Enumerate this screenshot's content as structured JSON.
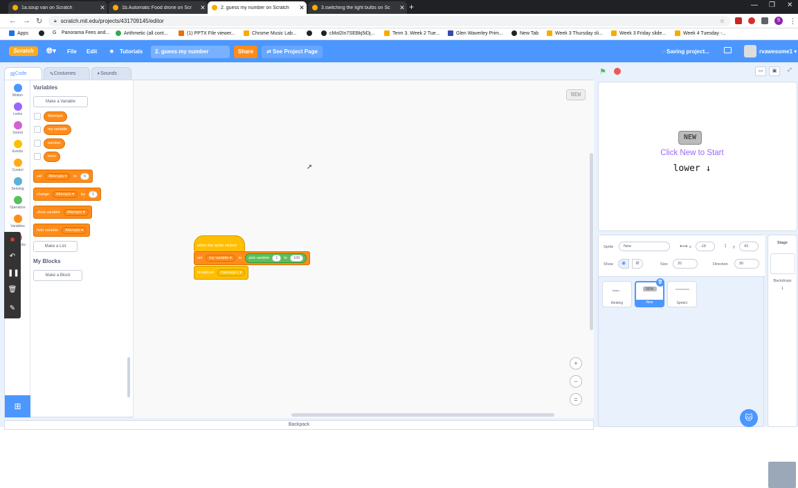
{
  "browser": {
    "tabs": [
      {
        "label": "1a.soup van on Scratch",
        "active": false
      },
      {
        "label": "1b.Automatic Food drone on Scr",
        "active": false
      },
      {
        "label": "2. guess my number on Scratch",
        "active": true
      },
      {
        "label": "3.switching the light bulbs on Sc",
        "active": false
      }
    ],
    "new_tab": "+",
    "url": "scratch.mit.edu/projects/431709145/editor",
    "profile_initial": "S",
    "bookmarks": [
      "Apps",
      "G",
      "Panorama Fees and...",
      "Arithmetic (all cont...",
      "(1) PPTX File viewer...",
      "Chrome Music Lab...",
      "cMol2In7SEBkj5iDj...",
      "Term 3. Week 2 Tue...",
      "Glen Waverley Prim...",
      "New Tab",
      "Week 3 Thursday sli...",
      "Week 3 Friday slide...",
      "Week 4 Tuesday -..."
    ]
  },
  "menubar": {
    "logo": "Scratch",
    "file": "File",
    "edit": "Edit",
    "tutorials": "Tutorials",
    "project_title": "2. guess my number",
    "share": "Share",
    "see_project_page": "See Project Page",
    "saving": "Saving project...",
    "username": "rvawesome1",
    "color": "#4c97ff"
  },
  "editor_tabs": {
    "code": "Code",
    "costumes": "Costumes",
    "sounds": "Sounds"
  },
  "categories": [
    {
      "label": "Motion",
      "color": "#4c97ff"
    },
    {
      "label": "Looks",
      "color": "#9966ff"
    },
    {
      "label": "Sound",
      "color": "#cf63cf"
    },
    {
      "label": "Events",
      "color": "#ffbf00"
    },
    {
      "label": "Control",
      "color": "#ffab19"
    },
    {
      "label": "Sensing",
      "color": "#5cb1d6"
    },
    {
      "label": "Operators",
      "color": "#59c059"
    },
    {
      "label": "Variables",
      "color": "#ff8c1a"
    },
    {
      "label": "My Blocks",
      "color": "#ff6680"
    }
  ],
  "palette": {
    "variables_title": "Variables",
    "make_variable": "Make a Variable",
    "variables": [
      "Attempts",
      "my variable",
      "number",
      "timer"
    ],
    "set_block": {
      "kw": "set",
      "var": "Attempts",
      "to": "to",
      "value": "0"
    },
    "change_block": {
      "kw": "change",
      "var": "Attempts",
      "by": "by",
      "value": "1"
    },
    "show_block": {
      "kw": "show variable",
      "var": "Attempts"
    },
    "hide_block": {
      "kw": "hide variable",
      "var": "Attempts"
    },
    "make_list": "Make a List",
    "my_blocks_title": "My Blocks",
    "make_block": "Make a Block"
  },
  "workspace": {
    "new_label": "NEW",
    "hat": "when this sprite clicked",
    "set_kw": "set",
    "set_var": "my variable",
    "set_to": "to",
    "random": "pick random",
    "random_from": "1",
    "random_and": "to",
    "random_to": "100",
    "broadcast": "broadcast",
    "message": "message1"
  },
  "backpack": "Backpack",
  "stage": {
    "new_button": "NEW",
    "message": "Click New to Start",
    "lower_text": "lower ↓"
  },
  "sprite_info": {
    "sprite_label": "Sprite",
    "sprite_name": "New",
    "x_label": "x",
    "x": "-18",
    "y_label": "y",
    "y": "43",
    "show_label": "Show",
    "size_label": "Size",
    "size": "20",
    "direction_label": "Direction",
    "direction": "90"
  },
  "sprites": [
    {
      "name": "thinking",
      "preview": "lower ↓",
      "selected": false
    },
    {
      "name": "New",
      "preview": "NEW",
      "selected": true
    },
    {
      "name": "Sprite1",
      "preview": "",
      "selected": false
    }
  ],
  "stage_pane": {
    "title": "Stage",
    "backdrops_label": "Backdrops",
    "backdrops_count": "1"
  }
}
